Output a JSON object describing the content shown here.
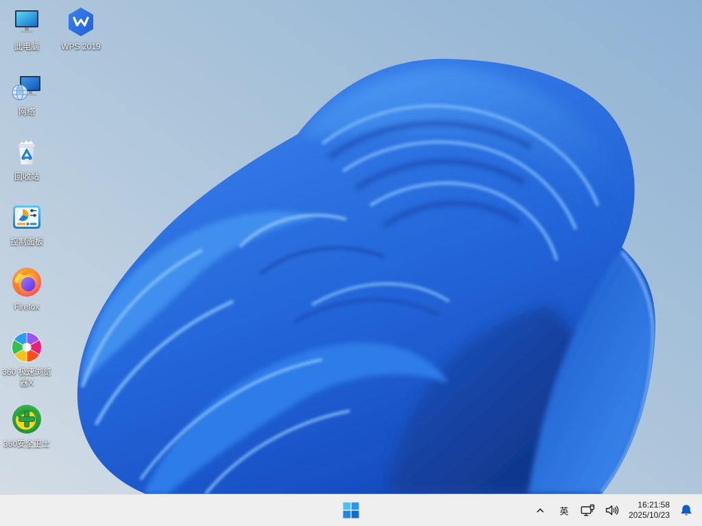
{
  "wallpaper": {
    "style_name": "windows-11-bloom",
    "colors": {
      "background_bottom_left": "#d3dce5",
      "background_top_right": "#8fb2d4",
      "bloom_primary": "#2f7ce8",
      "bloom_deep_shadow": "#0d2f7c",
      "bloom_highlight": "#85c0f8"
    }
  },
  "desktop": {
    "icons": [
      {
        "id": "this-pc",
        "label": "此电脑",
        "icon": "monitor-icon"
      },
      {
        "id": "wps-2019",
        "label": "WPS 2019",
        "icon": "wps-hexagon-icon"
      },
      {
        "id": "network",
        "label": "网络",
        "icon": "network-globe-icon"
      },
      {
        "id": "recycle-bin",
        "label": "回收站",
        "icon": "recycle-bin-icon"
      },
      {
        "id": "control-panel",
        "label": "控制面板",
        "icon": "control-panel-icon"
      },
      {
        "id": "firefox",
        "label": "Firefox",
        "icon": "firefox-icon"
      },
      {
        "id": "360-speed-browser",
        "label": "360 极速浏览器X",
        "icon": "rainbow-pinwheel-icon"
      },
      {
        "id": "360-safety-guard",
        "label": "360安全卫士",
        "icon": "green-cross-icon"
      }
    ]
  },
  "taskbar": {
    "start": {
      "icon": "windows-logo-icon"
    },
    "tray": {
      "ime_label": "英",
      "clock": {
        "time": "16:21:58",
        "date": "2025/10/23"
      },
      "icons": [
        "chevron-up-icon",
        "wired-network-icon",
        "volume-icon",
        "notification-bell-icon"
      ],
      "bell_color": "#0a5cd1"
    }
  }
}
